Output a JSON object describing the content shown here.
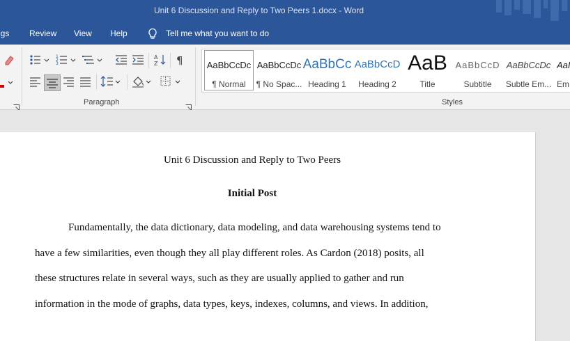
{
  "window": {
    "title": "Unit 6 Discussion and Reply to Two Peers 1.docx  -  Word"
  },
  "menu": {
    "items": [
      "ngs",
      "Review",
      "View",
      "Help"
    ],
    "tell_me": "Tell me what you want to do"
  },
  "ribbon": {
    "paragraph_group_label": "Paragraph",
    "styles_group_label": "Styles",
    "styles": [
      {
        "sample": "AaBbCcDc",
        "name": "¶ Normal"
      },
      {
        "sample": "AaBbCcDc",
        "name": "¶ No Spac..."
      },
      {
        "sample": "AaBbCc",
        "name": "Heading 1"
      },
      {
        "sample": "AaBbCcD",
        "name": "Heading 2"
      },
      {
        "sample": "AaB",
        "name": "Title"
      },
      {
        "sample": "AaBbCcD",
        "name": "Subtitle"
      },
      {
        "sample": "AaBbCcDc",
        "name": "Subtle Em..."
      },
      {
        "sample": "AaI",
        "name": "Em"
      }
    ]
  },
  "document": {
    "title": "Unit 6 Discussion and Reply to Two Peers",
    "heading": "Initial Post",
    "lines": [
      "Fundamentally, the data dictionary, data modeling, and data warehousing systems tend to",
      "have a few similarities, even though they all play different roles. As Cardon (2018) posits, all",
      "these structures relate in several ways, such as they are usually applied to gather and run",
      "information in the mode of graphs, data types, keys, indexes, columns, and views. In addition,"
    ]
  },
  "colors": {
    "brand_blue": "#2b579a",
    "heading_blue": "#2e74b5"
  }
}
